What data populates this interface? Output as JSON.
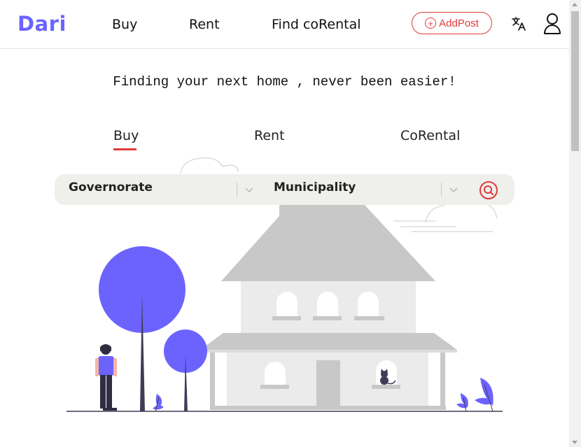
{
  "header": {
    "logo": "Dari",
    "nav": [
      {
        "label": "Buy"
      },
      {
        "label": "Rent"
      },
      {
        "label": "Find coRental"
      }
    ],
    "add_post_label": "AddPost",
    "translate_icon": "translate-icon",
    "user_icon": "user-icon"
  },
  "hero": {
    "tagline": "Finding your next home , never been easier!",
    "tabs": [
      {
        "label": "Buy",
        "active": true
      },
      {
        "label": "Rent",
        "active": false
      },
      {
        "label": "CoRental",
        "active": false
      }
    ]
  },
  "search": {
    "governorate_label": "Governorate",
    "municipality_label": "Municipality",
    "search_icon": "search-icon"
  },
  "colors": {
    "brand": "#6c63ff",
    "accent": "#e03a3a",
    "search_bg": "#efefeb"
  }
}
